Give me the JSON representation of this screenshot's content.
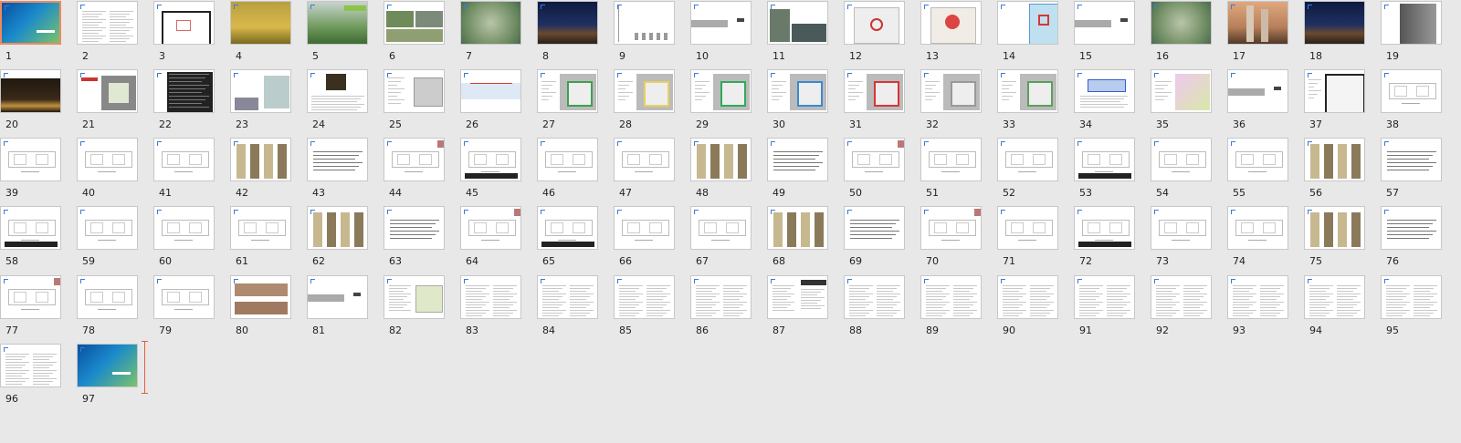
{
  "slides": [
    {
      "n": "1",
      "t": "cover"
    },
    {
      "n": "2",
      "t": "text"
    },
    {
      "n": "3",
      "t": "plan"
    },
    {
      "n": "4",
      "t": "photo-yellow"
    },
    {
      "n": "5",
      "t": "photo-green"
    },
    {
      "n": "6",
      "t": "photo-mix"
    },
    {
      "n": "7",
      "t": "aerial"
    },
    {
      "n": "8",
      "t": "night"
    },
    {
      "n": "9",
      "t": "blank-list"
    },
    {
      "n": "10",
      "t": "section"
    },
    {
      "n": "11",
      "t": "photo-street"
    },
    {
      "n": "12",
      "t": "map"
    },
    {
      "n": "13",
      "t": "map-red"
    },
    {
      "n": "14",
      "t": "map-blue"
    },
    {
      "n": "15",
      "t": "section"
    },
    {
      "n": "16",
      "t": "aerial"
    },
    {
      "n": "17",
      "t": "towers"
    },
    {
      "n": "18",
      "t": "night"
    },
    {
      "n": "19",
      "t": "tower-edge"
    },
    {
      "n": "20",
      "t": "night-lobby"
    },
    {
      "n": "21",
      "t": "site-plan"
    },
    {
      "n": "22",
      "t": "dark-table"
    },
    {
      "n": "23",
      "t": "site-mix"
    },
    {
      "n": "24",
      "t": "photo-text"
    },
    {
      "n": "25",
      "t": "plan-text"
    },
    {
      "n": "26",
      "t": "section-red"
    },
    {
      "n": "27",
      "t": "site-color"
    },
    {
      "n": "28",
      "t": "site-yellow"
    },
    {
      "n": "29",
      "t": "site-green"
    },
    {
      "n": "30",
      "t": "site-blue"
    },
    {
      "n": "31",
      "t": "site-red"
    },
    {
      "n": "32",
      "t": "site-grey"
    },
    {
      "n": "33",
      "t": "site-green2"
    },
    {
      "n": "34",
      "t": "plan-blue"
    },
    {
      "n": "35",
      "t": "map-purple"
    },
    {
      "n": "36",
      "t": "section"
    },
    {
      "n": "37",
      "t": "plan-framed"
    },
    {
      "n": "38",
      "t": "floor"
    },
    {
      "n": "39",
      "t": "floor"
    },
    {
      "n": "40",
      "t": "floor"
    },
    {
      "n": "41",
      "t": "floor"
    },
    {
      "n": "42",
      "t": "elevation"
    },
    {
      "n": "43",
      "t": "lines"
    },
    {
      "n": "44",
      "t": "floor-tag"
    },
    {
      "n": "45",
      "t": "floor-table"
    },
    {
      "n": "46",
      "t": "floor"
    },
    {
      "n": "47",
      "t": "floor"
    },
    {
      "n": "48",
      "t": "elevation"
    },
    {
      "n": "49",
      "t": "lines"
    },
    {
      "n": "50",
      "t": "floor-tag"
    },
    {
      "n": "51",
      "t": "floor"
    },
    {
      "n": "52",
      "t": "floor"
    },
    {
      "n": "53",
      "t": "floor-table"
    },
    {
      "n": "54",
      "t": "floor"
    },
    {
      "n": "55",
      "t": "floor"
    },
    {
      "n": "56",
      "t": "elevation"
    },
    {
      "n": "57",
      "t": "lines"
    },
    {
      "n": "58",
      "t": "floor-table"
    },
    {
      "n": "59",
      "t": "floor"
    },
    {
      "n": "60",
      "t": "floor"
    },
    {
      "n": "61",
      "t": "floor"
    },
    {
      "n": "62",
      "t": "elevation"
    },
    {
      "n": "63",
      "t": "lines"
    },
    {
      "n": "64",
      "t": "floor-tag"
    },
    {
      "n": "65",
      "t": "floor-table"
    },
    {
      "n": "66",
      "t": "floor"
    },
    {
      "n": "67",
      "t": "floor"
    },
    {
      "n": "68",
      "t": "elevation"
    },
    {
      "n": "69",
      "t": "lines"
    },
    {
      "n": "70",
      "t": "floor-tag"
    },
    {
      "n": "71",
      "t": "floor"
    },
    {
      "n": "72",
      "t": "floor-table"
    },
    {
      "n": "73",
      "t": "floor"
    },
    {
      "n": "74",
      "t": "floor"
    },
    {
      "n": "75",
      "t": "elevation"
    },
    {
      "n": "76",
      "t": "lines"
    },
    {
      "n": "77",
      "t": "floor-tag"
    },
    {
      "n": "78",
      "t": "floor"
    },
    {
      "n": "79",
      "t": "floor"
    },
    {
      "n": "80",
      "t": "elevation-red"
    },
    {
      "n": "81",
      "t": "section"
    },
    {
      "n": "82",
      "t": "text-table"
    },
    {
      "n": "83",
      "t": "text"
    },
    {
      "n": "84",
      "t": "text"
    },
    {
      "n": "85",
      "t": "text"
    },
    {
      "n": "86",
      "t": "text"
    },
    {
      "n": "87",
      "t": "text-dark"
    },
    {
      "n": "88",
      "t": "text"
    },
    {
      "n": "89",
      "t": "text"
    },
    {
      "n": "90",
      "t": "text"
    },
    {
      "n": "91",
      "t": "text"
    },
    {
      "n": "92",
      "t": "text"
    },
    {
      "n": "93",
      "t": "text"
    },
    {
      "n": "94",
      "t": "text"
    },
    {
      "n": "95",
      "t": "text"
    },
    {
      "n": "96",
      "t": "text"
    },
    {
      "n": "97",
      "t": "cover"
    }
  ],
  "selected_slide": "1",
  "accent_color": "#f08a5d"
}
